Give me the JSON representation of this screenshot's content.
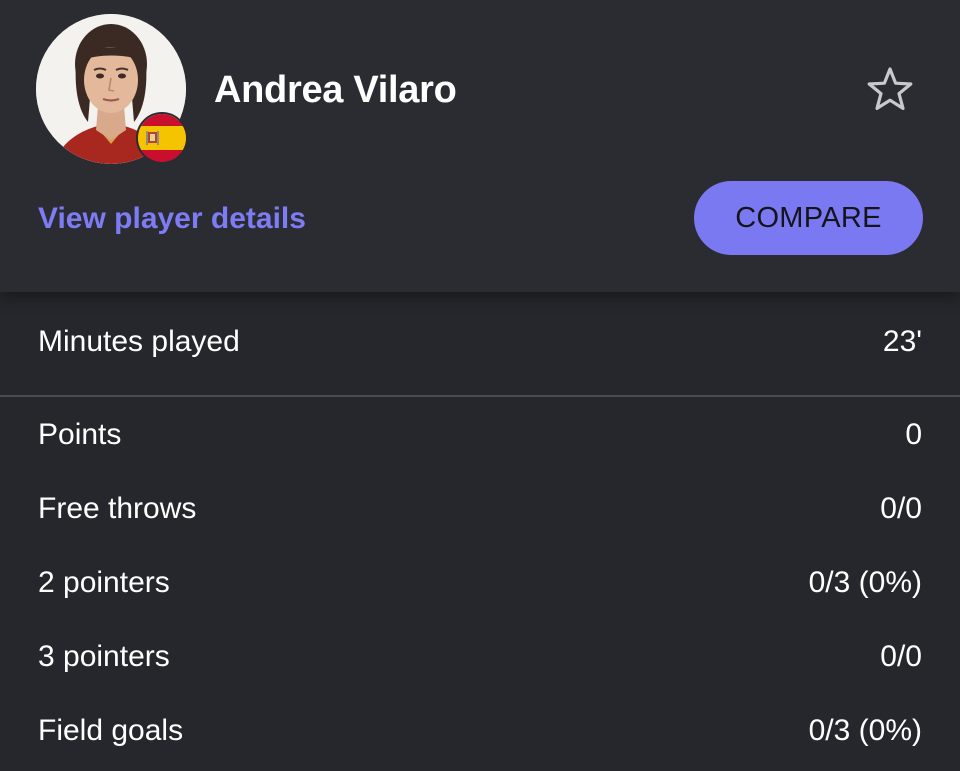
{
  "player": {
    "name": "Andrea Vilaro",
    "country_flag": "spain-flag",
    "details_link": "View player details",
    "compare_label": "COMPARE",
    "favorite_icon": "star-outline-icon"
  },
  "colors": {
    "background": "#26272c",
    "header_background": "#2b2c32",
    "accent": "#7b79f2",
    "link": "#7e7cf5",
    "divider": "#4a4b51"
  },
  "minutes": {
    "label": "Minutes played",
    "value": "23'"
  },
  "stats": [
    {
      "label": "Points",
      "value": "0"
    },
    {
      "label": "Free throws",
      "value": "0/0"
    },
    {
      "label": "2 pointers",
      "value": "0/3 (0%)"
    },
    {
      "label": "3 pointers",
      "value": "0/0"
    },
    {
      "label": "Field goals",
      "value": "0/3 (0%)"
    }
  ]
}
